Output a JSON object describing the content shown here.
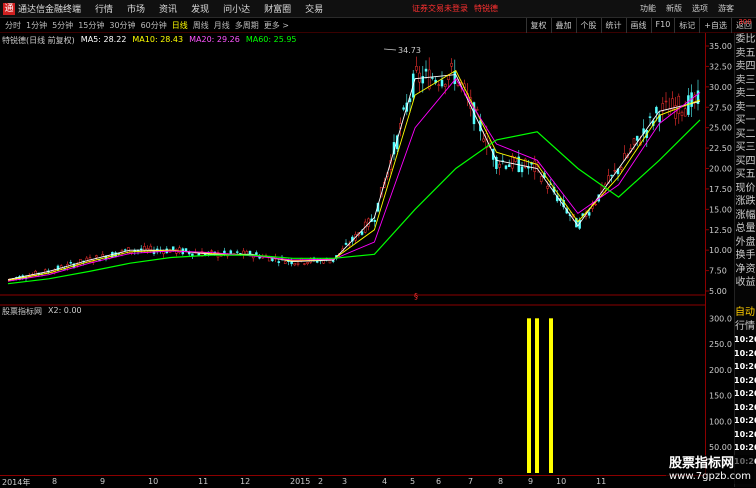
{
  "titlebar": {
    "logo": "通",
    "app_name": "通达信金融终端",
    "menu": [
      "行情",
      "市场",
      "资讯",
      "发现",
      "问小达",
      "财富圈",
      "交易"
    ],
    "notice": "证券交易未登录",
    "stock": "特锐德",
    "right_menu": [
      "功能",
      "新版",
      "选项",
      "游客"
    ]
  },
  "toolbar": {
    "periods": [
      "分时",
      "1分钟",
      "5分钟",
      "15分钟",
      "30分钟",
      "60分钟",
      "日线",
      "周线",
      "月线",
      "多周期",
      "更多 >"
    ],
    "active": "日线",
    "right_buttons": [
      "复权",
      "叠加",
      "个股",
      "统计",
      "画线",
      "F10",
      "标记",
      "+自选",
      "返回"
    ]
  },
  "main_chart": {
    "title": "特锐德(日线 前复权)",
    "ma": [
      {
        "label": "MA5: 28.22",
        "color": "#ffffff"
      },
      {
        "label": "MA10: 28.43",
        "color": "#ffff00"
      },
      {
        "label": "MA20: 29.26",
        "color": "#ff00ff"
      },
      {
        "label": "MA60: 25.95",
        "color": "#00ff00"
      }
    ],
    "peak_label": "34.73",
    "price_ticks": [
      "35.00",
      "32.50",
      "30.00",
      "27.50",
      "25.00",
      "22.50",
      "20.00",
      "17.50",
      "15.00",
      "12.50",
      "10.00",
      "7.50",
      "5.00"
    ]
  },
  "indicator": {
    "title": "股票指标网",
    "value": "X2: 0.00",
    "ticks": [
      "300.0",
      "250.0",
      "200.0",
      "150.0",
      "100.0",
      "50.00"
    ]
  },
  "x_axis": {
    "labels": [
      "2014年",
      "8",
      "9",
      "10",
      "11",
      "12",
      "2015",
      "2",
      "3",
      "4",
      "5",
      "6",
      "7",
      "8",
      "9",
      "10",
      "11"
    ]
  },
  "side_panel": {
    "top_label": "300",
    "items": [
      "委比",
      "卖五",
      "卖四",
      "卖三",
      "卖二",
      "卖一",
      "买一",
      "买二",
      "买三",
      "买四",
      "买五",
      "现价",
      "涨跌",
      "涨幅",
      "总量",
      "外盘",
      "换手",
      "净资",
      "收益"
    ],
    "auto": "自动",
    "quote": "行情",
    "times": [
      "10:26",
      "10:26",
      "10:26",
      "10:26",
      "10:26",
      "10:26",
      "10:26",
      "10:26",
      "10:26",
      "10:26"
    ]
  },
  "watermark": {
    "line1": "股票指标网",
    "line2": "www.7gpzb.com"
  },
  "chart_data": {
    "type": "line",
    "x": [
      "2014-07",
      "2014-08",
      "2014-09",
      "2014-10",
      "2014-11",
      "2014-12",
      "2015-01",
      "2015-02",
      "2015-03",
      "2015-04",
      "2015-05",
      "2015-06",
      "2015-07",
      "2015-08",
      "2015-09",
      "2015-10",
      "2015-11",
      "2015-12"
    ],
    "series": [
      {
        "name": "MA5",
        "values": [
          6.4,
          7.4,
          8.8,
          10.0,
          10.0,
          9.5,
          9.5,
          8.6,
          8.8,
          14.0,
          31.0,
          31.5,
          21.0,
          20.0,
          13.0,
          20.0,
          27.0,
          28.2
        ]
      },
      {
        "name": "MA10",
        "values": [
          6.3,
          7.2,
          8.6,
          9.8,
          10.0,
          9.6,
          9.4,
          8.7,
          8.9,
          12.5,
          29.0,
          32.0,
          22.0,
          20.5,
          13.5,
          19.0,
          26.5,
          28.4
        ]
      },
      {
        "name": "MA20",
        "values": [
          6.2,
          7.0,
          8.4,
          9.6,
          9.9,
          9.7,
          9.3,
          8.8,
          8.9,
          11.0,
          25.0,
          31.0,
          23.0,
          21.0,
          14.5,
          18.0,
          25.5,
          29.3
        ]
      },
      {
        "name": "MA60",
        "values": [
          5.9,
          6.5,
          7.4,
          8.4,
          9.1,
          9.4,
          9.4,
          9.0,
          9.0,
          9.5,
          15.0,
          20.0,
          23.5,
          24.5,
          20.0,
          16.5,
          21.0,
          25.95
        ]
      }
    ],
    "ylim": [
      5,
      35
    ],
    "indicator_bars": {
      "ylim": [
        0,
        320
      ],
      "values": [
        300,
        300,
        300
      ]
    }
  }
}
